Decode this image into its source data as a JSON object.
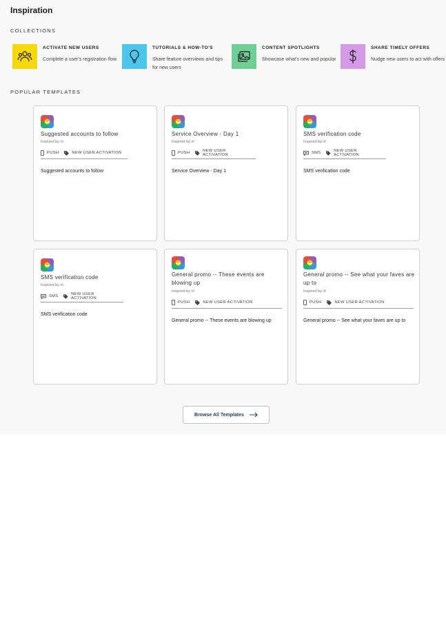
{
  "page_title": "Inspiration",
  "sections": {
    "collections": "COLLECTIONS",
    "popular": "POPULAR TEMPLATES"
  },
  "collections": [
    {
      "title": "ACTIVATE NEW USERS",
      "desc": "Complete a user's registration flow",
      "color": "#f5d90a",
      "icon": "users-icon"
    },
    {
      "title": "TUTORIALS & HOW-TO'S",
      "desc": "Share feature overviews and tips for new users",
      "color": "#4cc6ea",
      "icon": "lightbulb-icon"
    },
    {
      "title": "CONTENT SPOTLIGHTS",
      "desc": "Showcase what's new and popular",
      "color": "#6fcf97",
      "icon": "image-icon"
    },
    {
      "title": "SHARE TIMELY OFFERS",
      "desc": "Nudge new users to act with offers",
      "color": "#d49ae6",
      "icon": "dollar-icon"
    }
  ],
  "templates": [
    {
      "title": "Suggested accounts to follow",
      "inspired": "Inspired by irl",
      "channel": "PUSH",
      "tag": "NEW USER ACTIVATION",
      "body": "Suggested accounts to follow"
    },
    {
      "title": "Service Overview - Day 1",
      "inspired": "Inspired by irl",
      "channel": "PUSH",
      "tag": "NEW USER ACTIVATION",
      "body": "Service Overview - Day 1"
    },
    {
      "title": "SMS verification code",
      "inspired": "Inspired by irl",
      "channel": "SMS",
      "tag": "NEW USER ACTIVATION",
      "body": "SMS verification code"
    },
    {
      "title": "SMS verification code",
      "inspired": "Inspired by irl",
      "channel": "SMS",
      "tag": "NEW USER ACTIVATION",
      "body": "SMS verification code"
    },
    {
      "title": "General promo -- These events are blowing up",
      "inspired": "Inspired by irl",
      "channel": "PUSH",
      "tag": "NEW USER ACTIVATION",
      "body": "General promo -- These events are blowing up"
    },
    {
      "title": "General promo -- See what your faves are up to",
      "inspired": "Inspired by irl",
      "channel": "PUSH",
      "tag": "NEW USER ACTIVATION",
      "body": "General promo -- See what your faves are up to"
    }
  ],
  "browse_label": "Browse All Templates"
}
